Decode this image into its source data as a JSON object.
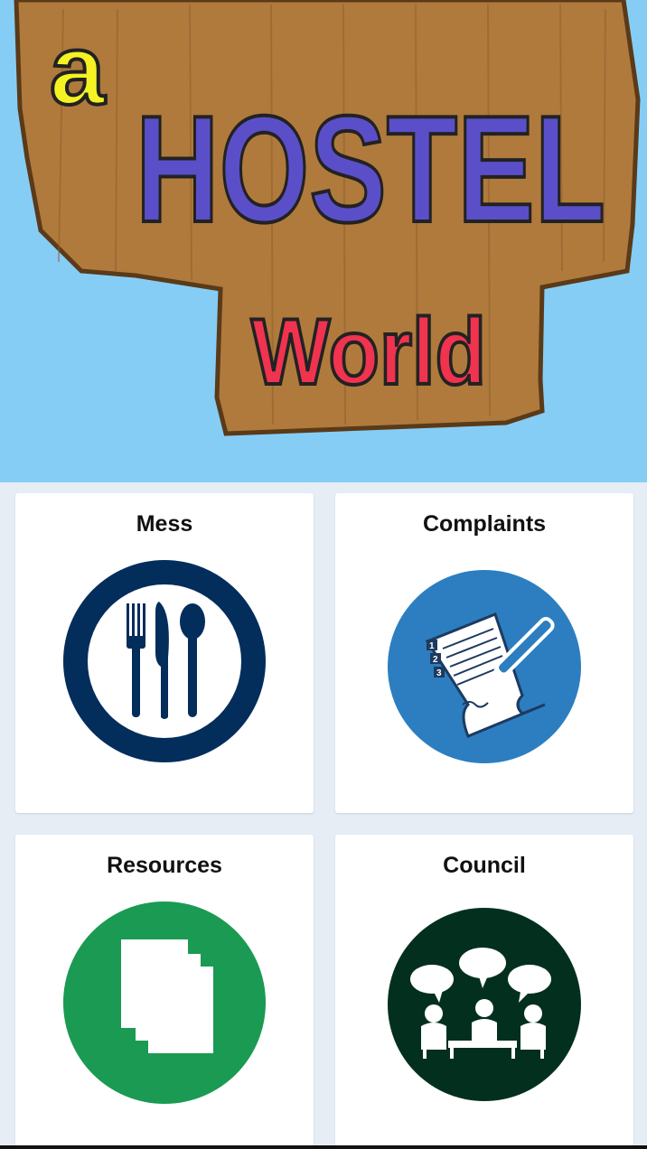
{
  "banner": {
    "sign_small": "a",
    "sign_main": "HOSTEL",
    "sign_sub": "World",
    "colors": {
      "sky": "#86cdf6",
      "wood": "#b07a3d",
      "letters_main": "#5b4fc9",
      "letters_small": "#f5f224",
      "letters_sub": "#f0334f"
    }
  },
  "tiles": [
    {
      "label": "Mess",
      "icon": "fork-knife-spoon-icon",
      "color": "#032d5b"
    },
    {
      "label": "Complaints",
      "icon": "paper-and-pen-icon",
      "color": "#2c7ec0"
    },
    {
      "label": "Resources",
      "icon": "documents-stack-icon",
      "color": "#1a9a52"
    },
    {
      "label": "Council",
      "icon": "meeting-people-icon",
      "color": "#03301e"
    }
  ],
  "complaints_list_numbers": [
    "1",
    "2",
    "3"
  ]
}
